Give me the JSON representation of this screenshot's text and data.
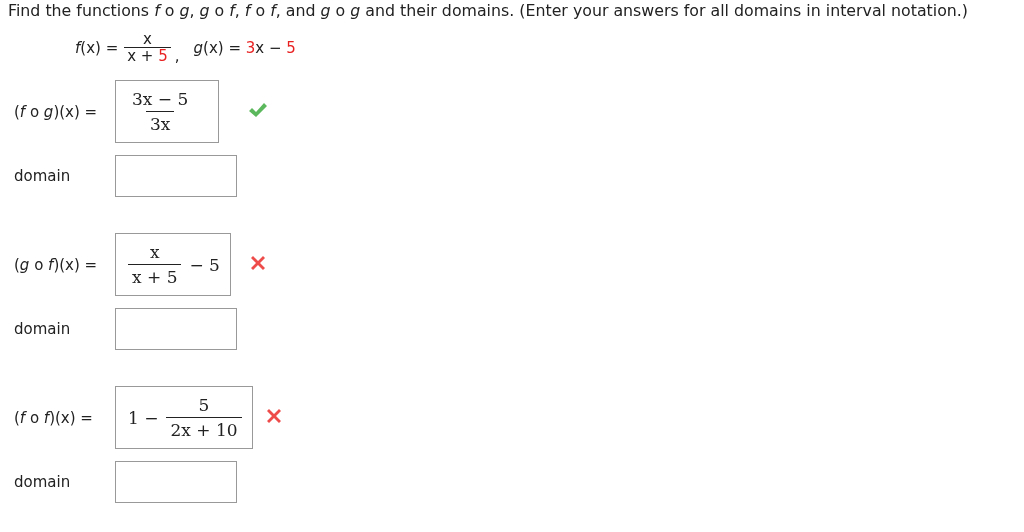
{
  "instructions": "Find the functions *f* o *g*, *g* o *f*, *f* o *f*, and *g* o *g* and their domains. (Enter your answers for all domains in interval notation.)",
  "given": {
    "f": {
      "label": "*f*(x) =",
      "numerator": "x",
      "denominator": [
        {
          "text": "x + ",
          "highlight": false
        },
        {
          "text": "5",
          "highlight": true
        }
      ],
      "separator": ","
    },
    "g": {
      "parts": [
        {
          "text": "*g*(x) = ",
          "highlight": false
        },
        {
          "text": "3",
          "highlight": true
        },
        {
          "text": "x − ",
          "highlight": false
        },
        {
          "text": "5",
          "highlight": true
        }
      ]
    }
  },
  "problems": [
    {
      "label": "(*f* o *g*)(x) =",
      "answer": [
        {
          "kind": "fraction",
          "numerator": "3x − 5",
          "denominator": "3x"
        }
      ],
      "correct": true,
      "domain": {
        "label": "domain"
      }
    },
    {
      "label": "(*g* o *f*)(x) =",
      "answer": [
        {
          "kind": "fraction",
          "numerator": "x",
          "denominator": "x + 5"
        },
        {
          "kind": "text",
          "text": "− 5"
        }
      ],
      "correct": false,
      "domain": {
        "label": "domain"
      }
    },
    {
      "label": "(*f* o *f*)(x) =",
      "answer": [
        {
          "kind": "text",
          "text": "1 −"
        },
        {
          "kind": "fraction",
          "numerator": "5",
          "denominator": "2x + 10"
        }
      ],
      "correct": false,
      "domain": {
        "label": "domain"
      }
    }
  ]
}
